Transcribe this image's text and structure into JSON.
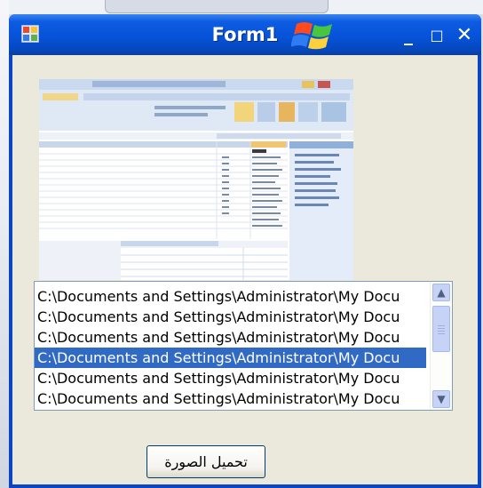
{
  "window": {
    "title": "Form1",
    "controls": {
      "minimize": "_",
      "maximize": "□",
      "close": "✕"
    }
  },
  "picturebox": {
    "description_icon": "image-preview",
    "ribbon_app_title": "Microsoft Access"
  },
  "listbox": {
    "items": [
      "C:\\Documents and Settings\\Administrator\\My Docu",
      "C:\\Documents and Settings\\Administrator\\My Docu",
      "C:\\Documents and Settings\\Administrator\\My Docu",
      "C:\\Documents and Settings\\Administrator\\My Docu",
      "C:\\Documents and Settings\\Administrator\\My Docu",
      "C:\\Documents and Settings\\Administrator\\My Docu"
    ],
    "selected_index": 3,
    "scroll": {
      "up_icon": "▲",
      "down_icon": "▼"
    }
  },
  "load_button": {
    "label": "تحميل الصورة"
  },
  "colors": {
    "titlebar": "#0653d9",
    "client": "#ebe9dc",
    "selection": "#316ac5"
  }
}
